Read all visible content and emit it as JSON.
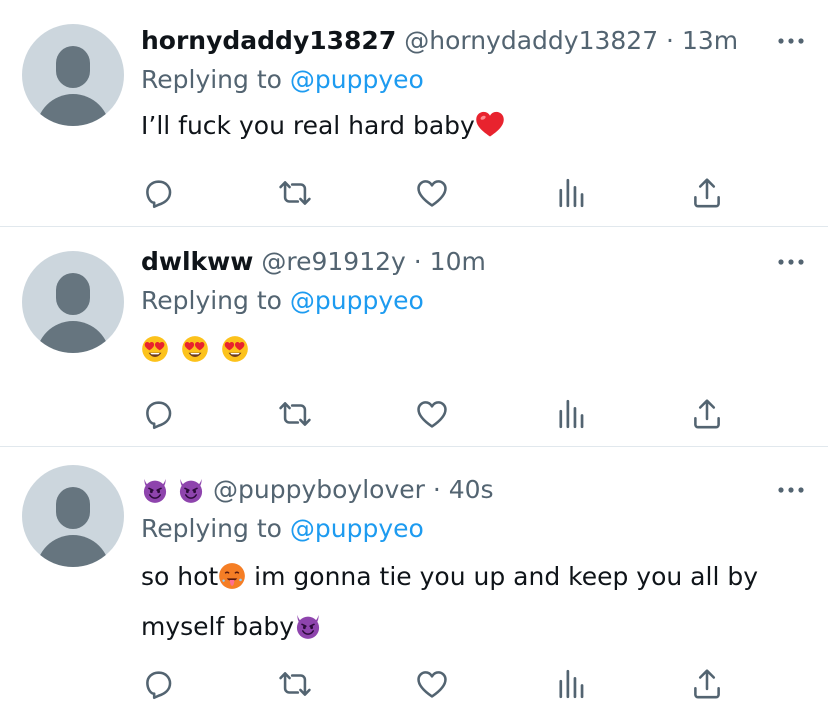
{
  "tweets": [
    {
      "name": "hornydaddy13827",
      "handle": "@hornydaddy13827",
      "time": "13m",
      "reply_prefix": "Replying to",
      "reply_to": "@puppyeo",
      "text": "I’ll fuck you real hard baby",
      "text_emoji": "red-heart"
    },
    {
      "name": "dwlkww",
      "handle": "@re91912y",
      "time": "10m",
      "reply_prefix": "Replying to",
      "reply_to": "@puppyeo",
      "text_emojis": [
        "heart-eyes",
        "heart-eyes",
        "heart-eyes"
      ]
    },
    {
      "name_emojis": [
        "smiling-devil",
        "smiling-devil"
      ],
      "handle": "@puppyboylover",
      "time": "40s",
      "reply_prefix": "Replying to",
      "reply_to": "@puppyeo",
      "text_line1_a": "so hot",
      "text_line1_b": " im gonna tie you up and keep you all by",
      "text_line2": "myself baby",
      "emoji_hot": "hot-face",
      "emoji_devil": "smiling-devil"
    }
  ],
  "icons": {
    "reply": "reply-icon",
    "retweet": "retweet-icon",
    "like": "like-icon",
    "analytics": "analytics-icon",
    "share": "share-icon",
    "more": "more-icon"
  },
  "colors": {
    "text": "#0f1419",
    "muted": "#536471",
    "link": "#1d9bf0",
    "divider": "#e1e8ed",
    "avatar_bg": "#ccd6dd",
    "avatar_fg": "#66757f"
  }
}
